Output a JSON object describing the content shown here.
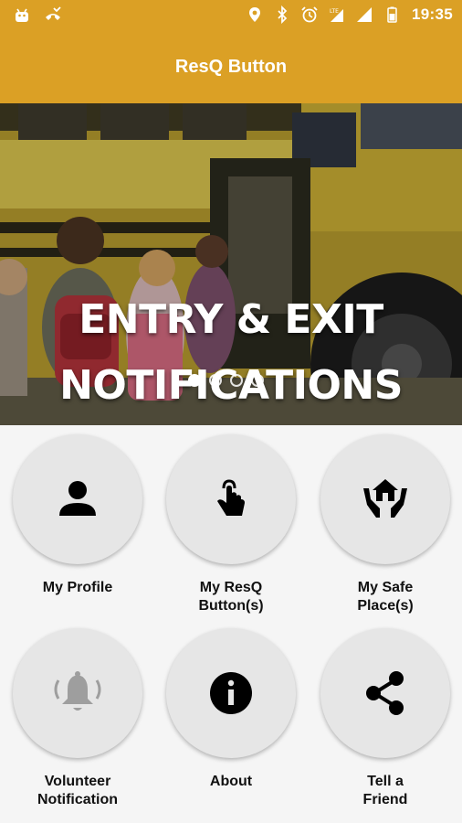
{
  "status_bar": {
    "time": "19:35",
    "left_icons": [
      "android-icon",
      "missed-call-icon"
    ],
    "right_icons": [
      "location-icon",
      "bluetooth-icon",
      "alarm-icon",
      "lte-signal-icon",
      "signal-icon",
      "battery-icon"
    ]
  },
  "app_bar": {
    "title": "ResQ Button"
  },
  "banner": {
    "line1": "ENTRY & EXIT",
    "line2": "NOTIFICATIONS",
    "slide_count": 4,
    "active_slide": 1
  },
  "tiles": [
    {
      "label_line1": "My Profile",
      "label_line2": "",
      "icon": "person-icon"
    },
    {
      "label_line1": "My ResQ",
      "label_line2": "Button(s)",
      "icon": "touch-icon"
    },
    {
      "label_line1": "My Safe",
      "label_line2": "Place(s)",
      "icon": "home-hands-icon"
    },
    {
      "label_line1": "Volunteer",
      "label_line2": "Notification",
      "icon": "bell-icon"
    },
    {
      "label_line1": "About",
      "label_line2": "",
      "icon": "info-icon"
    },
    {
      "label_line1": "Tell a",
      "label_line2": "Friend",
      "icon": "share-icon"
    }
  ],
  "colors": {
    "primary": "#dba025",
    "background": "#f5f5f5",
    "tile": "#e6e6e6",
    "bell_disabled": "#9e9e9e"
  }
}
